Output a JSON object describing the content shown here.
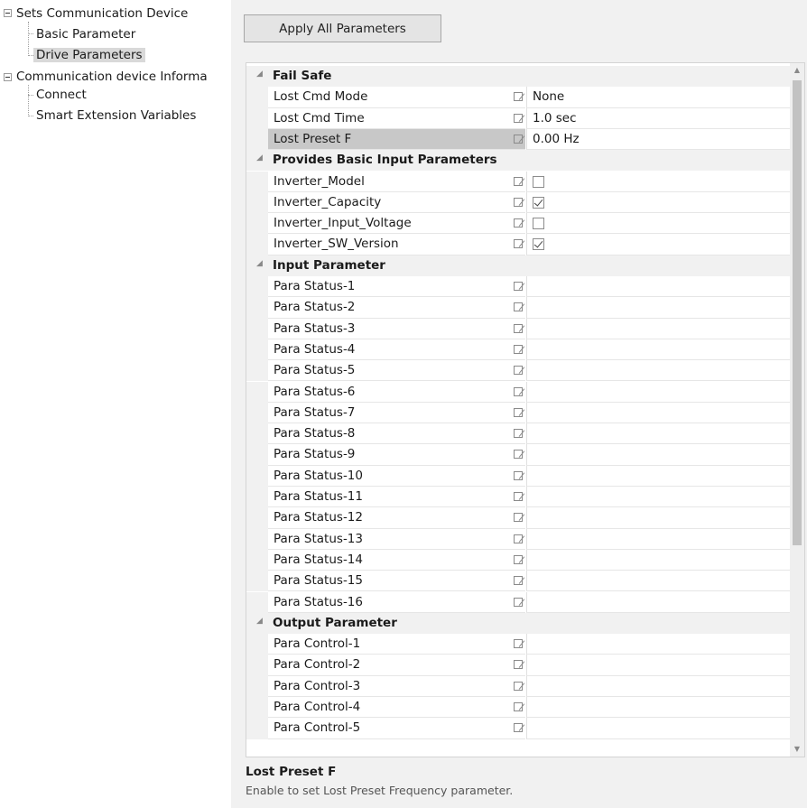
{
  "tree": {
    "root1": "Sets Communication Device",
    "basic": "Basic Parameter",
    "drive": "Drive Parameters",
    "root2": "Communication device Informa",
    "connect": "Connect",
    "smart": "Smart Extension Variables"
  },
  "toolbar": {
    "apply_label": "Apply All Parameters"
  },
  "grid": {
    "categories": [
      {
        "title": "Fail Safe",
        "rows": [
          {
            "name": "Lost Cmd Mode",
            "value": "None"
          },
          {
            "name": "Lost Cmd Time",
            "value": "1.0 sec"
          },
          {
            "name": "Lost Preset F",
            "value": "0.00 Hz",
            "selected": true
          }
        ]
      },
      {
        "title": "Provides Basic Input Parameters",
        "rows": [
          {
            "name": "Inverter_Model",
            "checked": false
          },
          {
            "name": "Inverter_Capacity",
            "checked": true
          },
          {
            "name": "Inverter_Input_Voltage",
            "checked": false
          },
          {
            "name": "Inverter_SW_Version",
            "checked": true
          }
        ]
      },
      {
        "title": "Input Parameter",
        "rows": [
          {
            "name": "Para Status-1",
            "value": ""
          },
          {
            "name": "Para Status-2",
            "value": ""
          },
          {
            "name": "Para Status-3",
            "value": ""
          },
          {
            "name": "Para Status-4",
            "value": ""
          },
          {
            "name": "Para Status-5",
            "value": ""
          },
          {
            "name": "Para Status-6",
            "value": ""
          },
          {
            "name": "Para Status-7",
            "value": ""
          },
          {
            "name": "Para Status-8",
            "value": ""
          },
          {
            "name": "Para Status-9",
            "value": ""
          },
          {
            "name": "Para Status-10",
            "value": ""
          },
          {
            "name": "Para Status-11",
            "value": ""
          },
          {
            "name": "Para Status-12",
            "value": ""
          },
          {
            "name": "Para Status-13",
            "value": ""
          },
          {
            "name": "Para Status-14",
            "value": ""
          },
          {
            "name": "Para Status-15",
            "value": ""
          },
          {
            "name": "Para Status-16",
            "value": ""
          }
        ]
      },
      {
        "title": "Output Parameter",
        "rows": [
          {
            "name": "Para Control-1",
            "value": ""
          },
          {
            "name": "Para Control-2",
            "value": ""
          },
          {
            "name": "Para Control-3",
            "value": ""
          },
          {
            "name": "Para Control-4",
            "value": ""
          },
          {
            "name": "Para Control-5",
            "value": ""
          }
        ]
      }
    ]
  },
  "description": {
    "title": "Lost Preset F",
    "text": "Enable to set Lost Preset Frequency parameter."
  }
}
